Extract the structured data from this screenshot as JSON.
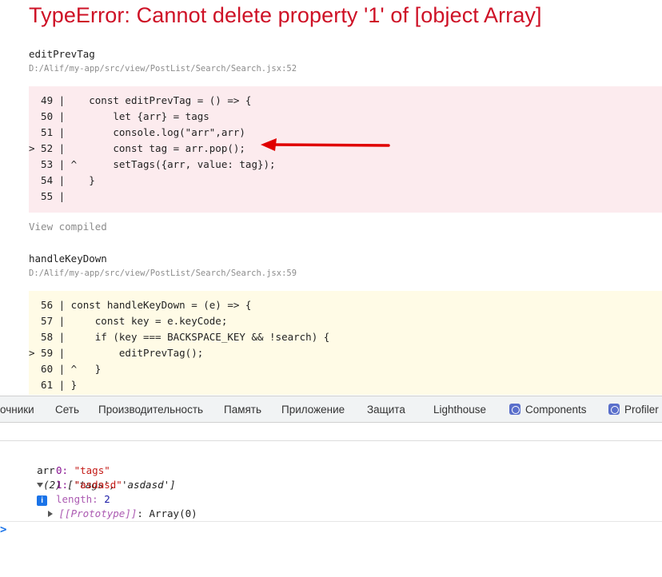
{
  "error": {
    "title": "TypeError: Cannot delete property '1' of [object Array]"
  },
  "frames": [
    {
      "function": "editPrevTag",
      "path": "D:/Alif/my-app/src/view/PostList/Search/Search.jsx:52",
      "lines": [
        {
          "gutter": "  49 |",
          "code": "    const editPrevTag = () => {"
        },
        {
          "gutter": "  50 |",
          "code": "        let {arr} = tags"
        },
        {
          "gutter": "  51 |",
          "code": "        console.log(\"arr\",arr)"
        },
        {
          "gutter": "> 52 |",
          "code": "        const tag = arr.pop();"
        },
        {
          "gutter": "  53 | ^",
          "code": "      setTags({arr, value: tag});"
        },
        {
          "gutter": "  54 |",
          "code": "    }"
        },
        {
          "gutter": "  55 |",
          "code": ""
        }
      ]
    },
    {
      "function": "handleKeyDown",
      "path": "D:/Alif/my-app/src/view/PostList/Search/Search.jsx:59",
      "lines": [
        {
          "gutter": "  56 |",
          "code": " const handleKeyDown = (e) => {"
        },
        {
          "gutter": "  57 |",
          "code": "     const key = e.keyCode;"
        },
        {
          "gutter": "  58 |",
          "code": "     if (key === BACKSPACE_KEY && !search) {"
        },
        {
          "gutter": "> 59 |",
          "code": "         editPrevTag();"
        },
        {
          "gutter": "  60 | ^",
          "code": "   }"
        },
        {
          "gutter": "  61 |",
          "code": " }"
        }
      ]
    }
  ],
  "view_compiled": "View compiled",
  "devtools": {
    "tabs": [
      {
        "label": "очники",
        "icon": ""
      },
      {
        "label": "Сеть",
        "icon": ""
      },
      {
        "label": "Производительность",
        "icon": ""
      },
      {
        "label": "Память",
        "icon": ""
      },
      {
        "label": "Приложение",
        "icon": ""
      },
      {
        "label": "Защита",
        "icon": ""
      },
      {
        "label": "Lighthouse",
        "icon": ""
      },
      {
        "label": "Components",
        "icon": "react-gem-icon"
      },
      {
        "label": "Profiler",
        "icon": "react-gem-icon"
      }
    ]
  },
  "console": {
    "var_name": "arr",
    "summary": "(2) ['tags', 'asdasd']",
    "info_badge": "i",
    "items": [
      {
        "key": "0",
        "value": "\"tags\""
      },
      {
        "key": "1",
        "value": "\"asdasd\""
      }
    ],
    "length_key": "length",
    "length_value": "2",
    "proto_key": "[[Prototype]]",
    "proto_value": "Array(0)",
    "prompt": ">"
  },
  "colors": {
    "error_red": "#ce1126",
    "error_bg": "#fcebee",
    "warn_bg": "#fffbe6",
    "annotation_arrow": "#e00000"
  }
}
